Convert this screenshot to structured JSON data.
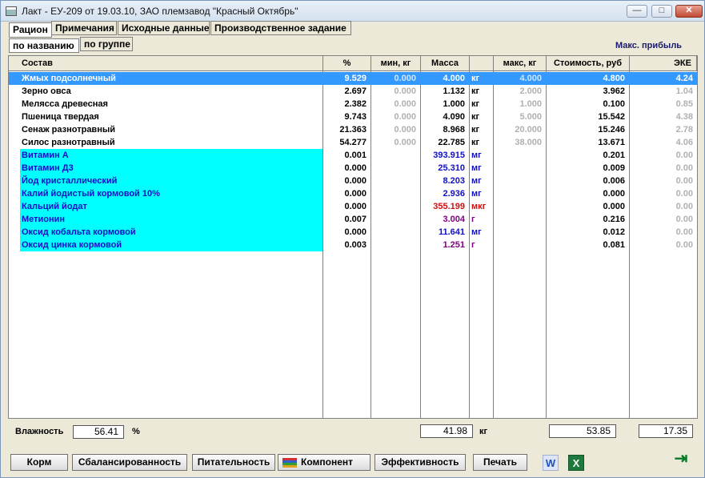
{
  "window": {
    "title": "Лакт - ЕУ-209 от 19.03.10,  ЗАО племзавод \"Красный Октябрь\"",
    "minimize": "—",
    "maximize": "□",
    "close": "✕"
  },
  "tabs": [
    {
      "label": "Рацион",
      "active": true
    },
    {
      "label": "Примечания",
      "active": false
    },
    {
      "label": "Исходные данные",
      "active": false
    },
    {
      "label": "Производственное задание",
      "active": false
    }
  ],
  "subtabs": [
    {
      "label": "по названию",
      "active": true
    },
    {
      "label": "по группе",
      "active": false
    }
  ],
  "optimization_label": "Макс. прибыль",
  "columns": {
    "name": "Состав",
    "pct": "%",
    "min": "мин, кг",
    "mass": "Масса",
    "unit": "",
    "max": "макс, кг",
    "cost": "Стоимость, руб",
    "eke": "ЭКЕ"
  },
  "rows": [
    {
      "name": "Жмых подсолнечный",
      "pct": "9.529",
      "min": "0.000",
      "mass": "4.000",
      "unit": "кг",
      "max": "4.000",
      "cost": "4.800",
      "eke": "4.24",
      "selected": true,
      "highlight": false,
      "mass_color": "black"
    },
    {
      "name": "Зерно овса",
      "pct": "2.697",
      "min": "0.000",
      "mass": "1.132",
      "unit": "кг",
      "max": "2.000",
      "cost": "3.962",
      "eke": "1.04",
      "selected": false,
      "highlight": false,
      "mass_color": "black"
    },
    {
      "name": "Мелясса древесная",
      "pct": "2.382",
      "min": "0.000",
      "mass": "1.000",
      "unit": "кг",
      "max": "1.000",
      "cost": "0.100",
      "eke": "0.85",
      "selected": false,
      "highlight": false,
      "mass_color": "black"
    },
    {
      "name": "Пшеница твердая",
      "pct": "9.743",
      "min": "0.000",
      "mass": "4.090",
      "unit": "кг",
      "max": "5.000",
      "cost": "15.542",
      "eke": "4.38",
      "selected": false,
      "highlight": false,
      "mass_color": "black"
    },
    {
      "name": "Сенаж разнотравный",
      "pct": "21.363",
      "min": "0.000",
      "mass": "8.968",
      "unit": "кг",
      "max": "20.000",
      "cost": "15.246",
      "eke": "2.78",
      "selected": false,
      "highlight": false,
      "mass_color": "black"
    },
    {
      "name": "Силос разнотравный",
      "pct": "54.277",
      "min": "0.000",
      "mass": "22.785",
      "unit": "кг",
      "max": "38.000",
      "cost": "13.671",
      "eke": "4.06",
      "selected": false,
      "highlight": false,
      "mass_color": "black"
    },
    {
      "name": "Витамин А",
      "pct": "0.001",
      "min": "",
      "mass": "393.915",
      "unit": "мг",
      "max": "",
      "cost": "0.201",
      "eke": "0.00",
      "selected": false,
      "highlight": true,
      "mass_color": "blue"
    },
    {
      "name": "Витамин Д3",
      "pct": "0.000",
      "min": "",
      "mass": "25.310",
      "unit": "мг",
      "max": "",
      "cost": "0.009",
      "eke": "0.00",
      "selected": false,
      "highlight": true,
      "mass_color": "blue"
    },
    {
      "name": "Йод кристаллический",
      "pct": "0.000",
      "min": "",
      "mass": "8.203",
      "unit": "мг",
      "max": "",
      "cost": "0.006",
      "eke": "0.00",
      "selected": false,
      "highlight": true,
      "mass_color": "blue"
    },
    {
      "name": "Калий йодистый кормовой 10%",
      "pct": "0.000",
      "min": "",
      "mass": "2.936",
      "unit": "мг",
      "max": "",
      "cost": "0.000",
      "eke": "0.00",
      "selected": false,
      "highlight": true,
      "mass_color": "blue"
    },
    {
      "name": "Кальций йодат",
      "pct": "0.000",
      "min": "",
      "mass": "355.199",
      "unit": "мкг",
      "max": "",
      "cost": "0.000",
      "eke": "0.00",
      "selected": false,
      "highlight": true,
      "mass_color": "red"
    },
    {
      "name": "Метионин",
      "pct": "0.007",
      "min": "",
      "mass": "3.004",
      "unit": "г",
      "max": "",
      "cost": "0.216",
      "eke": "0.00",
      "selected": false,
      "highlight": true,
      "mass_color": "purple"
    },
    {
      "name": "Оксид кобальта кормовой",
      "pct": "0.000",
      "min": "",
      "mass": "11.641",
      "unit": "мг",
      "max": "",
      "cost": "0.012",
      "eke": "0.00",
      "selected": false,
      "highlight": true,
      "mass_color": "blue"
    },
    {
      "name": "Оксид цинка кормовой",
      "pct": "0.003",
      "min": "",
      "mass": "1.251",
      "unit": "г",
      "max": "",
      "cost": "0.081",
      "eke": "0.00",
      "selected": false,
      "highlight": true,
      "mass_color": "purple"
    }
  ],
  "footer": {
    "humidity_label": "Влажность",
    "humidity_value": "56.41",
    "humidity_unit": "%",
    "mass_total": "41.98",
    "mass_unit": "кг",
    "cost_total": "53.85",
    "eke_total": "17.35"
  },
  "buttons": {
    "feed": "Корм",
    "balance": "Сбалансированность",
    "nutrition": "Питательность",
    "component": "Компонент",
    "efficiency": "Эффективность",
    "print": "Печать"
  },
  "icons": {
    "word": "word-icon",
    "excel": "excel-icon",
    "exit": "exit-door-icon",
    "component": "component-bars-icon",
    "app": "app-icon"
  },
  "colors": {
    "selection": "#3399ff",
    "highlight": "#00ffff",
    "name_blue": "#1010c8",
    "red": "#d01010",
    "purple": "#800080"
  }
}
